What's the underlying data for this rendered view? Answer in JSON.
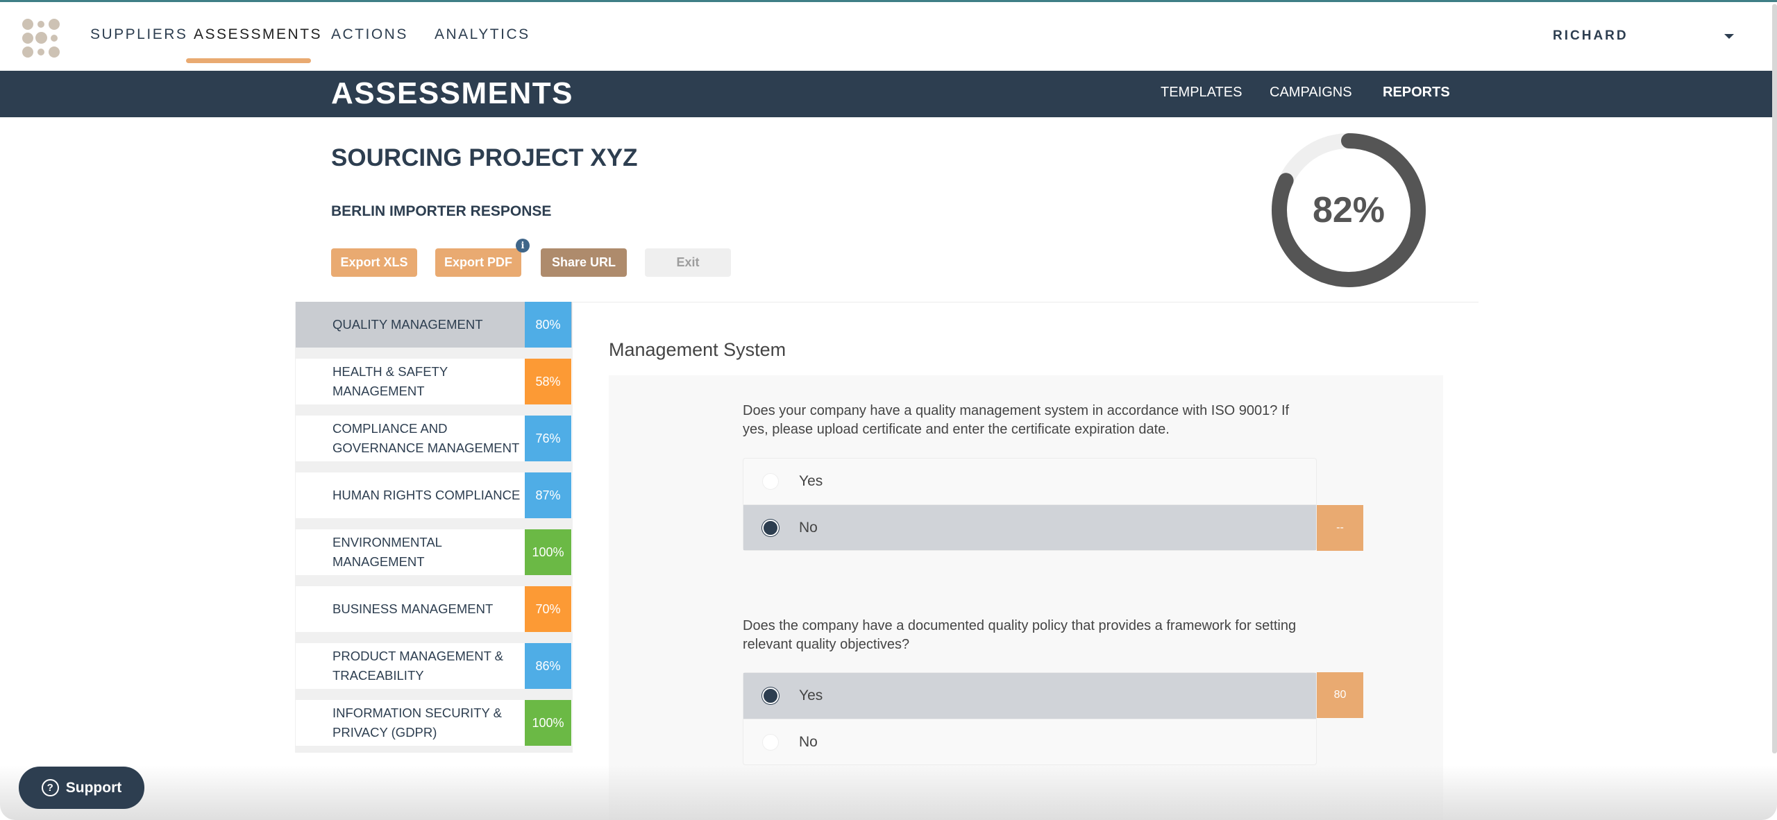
{
  "topnav": {
    "items": [
      {
        "label": "SUPPLIERS"
      },
      {
        "label": "ASSESSMENTS",
        "active": true
      },
      {
        "label": "ACTIONS"
      },
      {
        "label": "ANALYTICS"
      }
    ],
    "user": "RICHARD",
    "accent_color": "#e9aa71"
  },
  "subbar": {
    "title": "ASSESSMENTS",
    "tabs": [
      {
        "label": "TEMPLATES"
      },
      {
        "label": "CAMPAIGNS"
      },
      {
        "label": "REPORTS",
        "active": true
      }
    ],
    "background": "#2d3e50"
  },
  "project": {
    "title": "SOURCING PROJECT XYZ",
    "response": "BERLIN IMPORTER RESPONSE",
    "buttons": {
      "export_xls": "Export XLS",
      "export_pdf": "Export PDF",
      "share_url": "Share URL",
      "exit": "Exit"
    },
    "info_glyph": "i",
    "overall_score": {
      "value": 82,
      "label": "82%"
    }
  },
  "categories": [
    {
      "label": "QUALITY MANAGEMENT",
      "score": "80%",
      "color": "#4fade6",
      "selected": true
    },
    {
      "label": "HEALTH & SAFETY MANAGEMENT",
      "score": "58%",
      "color": "#fc9a35"
    },
    {
      "label": "COMPLIANCE AND GOVERNANCE MANAGEMENT",
      "score": "76%",
      "color": "#4fade6"
    },
    {
      "label": "HUMAN RIGHTS COMPLIANCE",
      "score": "87%",
      "color": "#4fade6"
    },
    {
      "label": "ENVIRONMENTAL MANAGEMENT",
      "score": "100%",
      "color": "#6bb945"
    },
    {
      "label": "BUSINESS MANAGEMENT",
      "score": "70%",
      "color": "#fc9a35"
    },
    {
      "label": "PRODUCT MANAGEMENT & TRACEABILITY",
      "score": "86%",
      "color": "#4fade6"
    },
    {
      "label": "INFORMATION SECURITY & PRIVACY (GDPR)",
      "score": "100%",
      "color": "#6bb945"
    }
  ],
  "section": {
    "title": "Management System",
    "questions": [
      {
        "text": "Does your company have a quality management system in accordance with ISO 9001? If yes, please upload certificate and enter the certificate expiration date.",
        "options": [
          {
            "label": "Yes",
            "checked": false
          },
          {
            "label": "No",
            "checked": true
          }
        ],
        "score": "--"
      },
      {
        "text": "Does the company have a documented quality policy that provides a framework for setting relevant quality objectives?",
        "options": [
          {
            "label": "Yes",
            "checked": true
          },
          {
            "label": "No",
            "checked": false
          }
        ],
        "score": "80"
      }
    ]
  },
  "support": {
    "label": "Support",
    "icon": "?"
  }
}
